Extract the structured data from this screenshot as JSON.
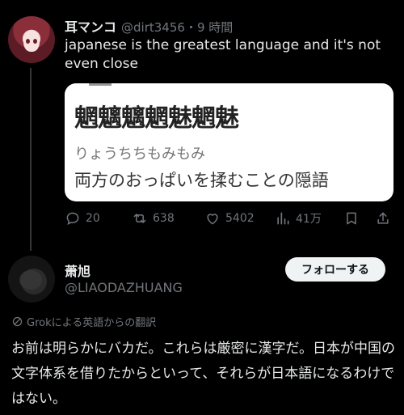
{
  "post": {
    "author_name": "耳マンコ",
    "author_handle": "@dirt3456",
    "time": "・9 時間",
    "text": "japanese is the greatest language and it's not even close",
    "image": {
      "kanji": "魍魑魑魍魅魍魅",
      "reading": "りょうちちもみもみ",
      "meaning": "両方のおっぱいを揉むことの隠語"
    },
    "actions": {
      "replies": "20",
      "reposts": "638",
      "likes": "5402",
      "views": "41万"
    }
  },
  "reply": {
    "author_name": "萧旭",
    "author_handle": "@LIAODAZHUANG",
    "follow_label": "フォローする",
    "translation_note": "Grokによる英語からの翻訳",
    "text": "お前は明らかにバカだ。これらは厳密に漢字だ。日本が中国の文字体系を借りたからといって、それらが日本語になるわけではない。"
  },
  "icons": [
    "reply-icon",
    "repost-icon",
    "like-icon",
    "views-icon",
    "bookmark-icon",
    "share-icon",
    "grok-icon"
  ]
}
